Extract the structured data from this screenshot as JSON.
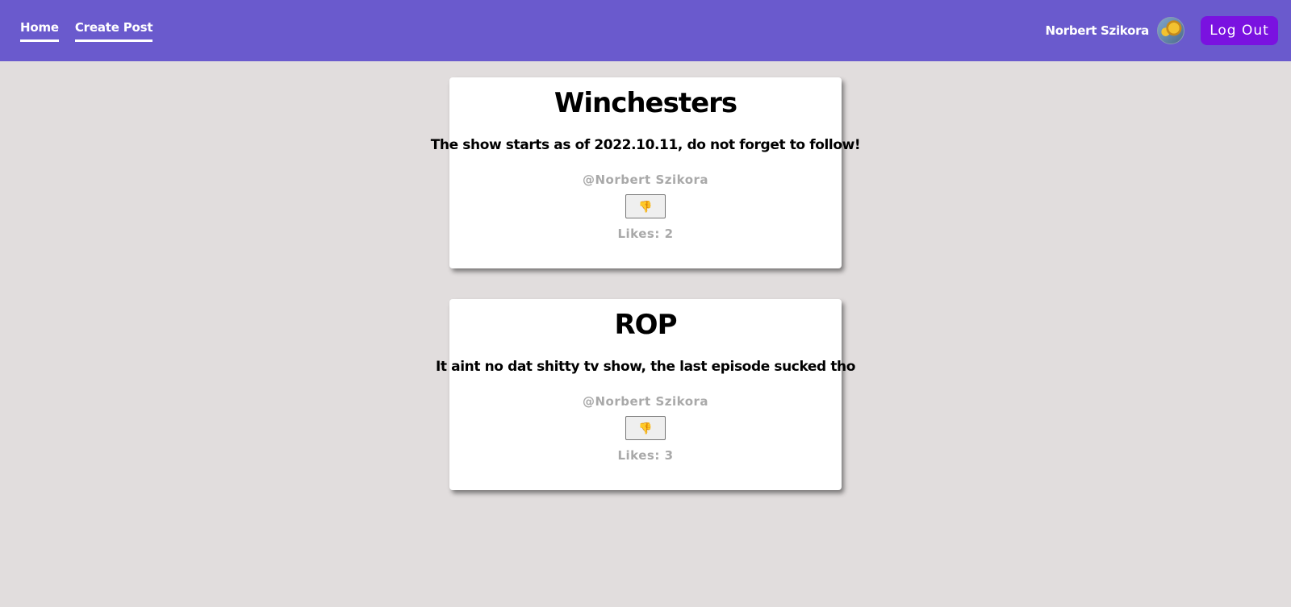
{
  "nav": {
    "links": [
      {
        "label": "Home"
      },
      {
        "label": "Create Post"
      }
    ],
    "user_name": "Norbert Szikora",
    "logout_label": "Log Out"
  },
  "colors": {
    "navbar": "#6a5acd",
    "page_background": "#e1dddd",
    "logout_button": "#7a12e0",
    "muted_text": "#a9a9a9"
  },
  "posts": [
    {
      "title": "Winchesters",
      "text": "The show starts as of 2022.10.11, do not forget to follow!",
      "author": "@Norbert Szikora",
      "button_icon": "thumbs-down-icon",
      "likes_label": "Likes: ",
      "likes": "2"
    },
    {
      "title": "ROP",
      "text": "It aint no dat shitty tv show, the last episode sucked tho",
      "author": "@Norbert Szikora",
      "button_icon": "thumbs-down-icon",
      "likes_label": "Likes: ",
      "likes": "3"
    }
  ]
}
